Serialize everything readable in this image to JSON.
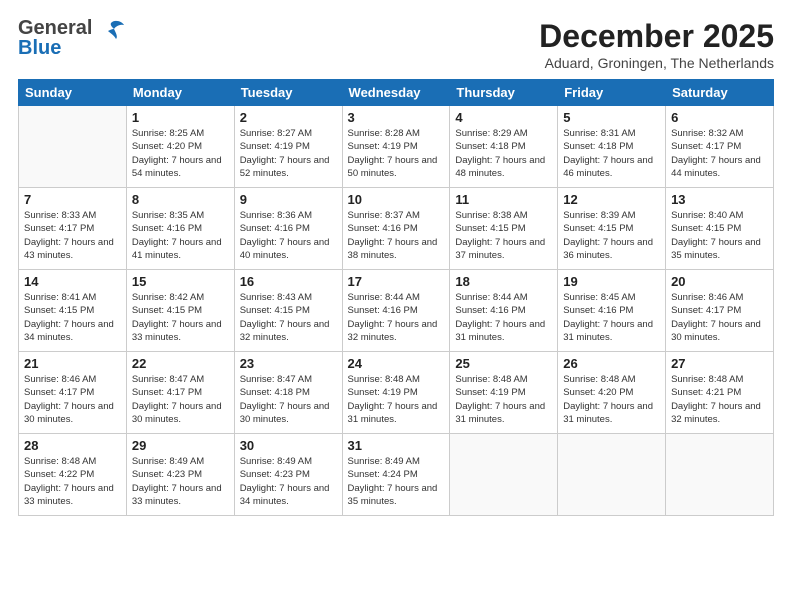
{
  "header": {
    "logo_general": "General",
    "logo_blue": "Blue",
    "month_title": "December 2025",
    "location": "Aduard, Groningen, The Netherlands"
  },
  "weekdays": [
    "Sunday",
    "Monday",
    "Tuesday",
    "Wednesday",
    "Thursday",
    "Friday",
    "Saturday"
  ],
  "weeks": [
    [
      {
        "day": "",
        "sunrise": "",
        "sunset": "",
        "daylight": ""
      },
      {
        "day": "1",
        "sunrise": "Sunrise: 8:25 AM",
        "sunset": "Sunset: 4:20 PM",
        "daylight": "Daylight: 7 hours and 54 minutes."
      },
      {
        "day": "2",
        "sunrise": "Sunrise: 8:27 AM",
        "sunset": "Sunset: 4:19 PM",
        "daylight": "Daylight: 7 hours and 52 minutes."
      },
      {
        "day": "3",
        "sunrise": "Sunrise: 8:28 AM",
        "sunset": "Sunset: 4:19 PM",
        "daylight": "Daylight: 7 hours and 50 minutes."
      },
      {
        "day": "4",
        "sunrise": "Sunrise: 8:29 AM",
        "sunset": "Sunset: 4:18 PM",
        "daylight": "Daylight: 7 hours and 48 minutes."
      },
      {
        "day": "5",
        "sunrise": "Sunrise: 8:31 AM",
        "sunset": "Sunset: 4:18 PM",
        "daylight": "Daylight: 7 hours and 46 minutes."
      },
      {
        "day": "6",
        "sunrise": "Sunrise: 8:32 AM",
        "sunset": "Sunset: 4:17 PM",
        "daylight": "Daylight: 7 hours and 44 minutes."
      }
    ],
    [
      {
        "day": "7",
        "sunrise": "Sunrise: 8:33 AM",
        "sunset": "Sunset: 4:17 PM",
        "daylight": "Daylight: 7 hours and 43 minutes."
      },
      {
        "day": "8",
        "sunrise": "Sunrise: 8:35 AM",
        "sunset": "Sunset: 4:16 PM",
        "daylight": "Daylight: 7 hours and 41 minutes."
      },
      {
        "day": "9",
        "sunrise": "Sunrise: 8:36 AM",
        "sunset": "Sunset: 4:16 PM",
        "daylight": "Daylight: 7 hours and 40 minutes."
      },
      {
        "day": "10",
        "sunrise": "Sunrise: 8:37 AM",
        "sunset": "Sunset: 4:16 PM",
        "daylight": "Daylight: 7 hours and 38 minutes."
      },
      {
        "day": "11",
        "sunrise": "Sunrise: 8:38 AM",
        "sunset": "Sunset: 4:15 PM",
        "daylight": "Daylight: 7 hours and 37 minutes."
      },
      {
        "day": "12",
        "sunrise": "Sunrise: 8:39 AM",
        "sunset": "Sunset: 4:15 PM",
        "daylight": "Daylight: 7 hours and 36 minutes."
      },
      {
        "day": "13",
        "sunrise": "Sunrise: 8:40 AM",
        "sunset": "Sunset: 4:15 PM",
        "daylight": "Daylight: 7 hours and 35 minutes."
      }
    ],
    [
      {
        "day": "14",
        "sunrise": "Sunrise: 8:41 AM",
        "sunset": "Sunset: 4:15 PM",
        "daylight": "Daylight: 7 hours and 34 minutes."
      },
      {
        "day": "15",
        "sunrise": "Sunrise: 8:42 AM",
        "sunset": "Sunset: 4:15 PM",
        "daylight": "Daylight: 7 hours and 33 minutes."
      },
      {
        "day": "16",
        "sunrise": "Sunrise: 8:43 AM",
        "sunset": "Sunset: 4:15 PM",
        "daylight": "Daylight: 7 hours and 32 minutes."
      },
      {
        "day": "17",
        "sunrise": "Sunrise: 8:44 AM",
        "sunset": "Sunset: 4:16 PM",
        "daylight": "Daylight: 7 hours and 32 minutes."
      },
      {
        "day": "18",
        "sunrise": "Sunrise: 8:44 AM",
        "sunset": "Sunset: 4:16 PM",
        "daylight": "Daylight: 7 hours and 31 minutes."
      },
      {
        "day": "19",
        "sunrise": "Sunrise: 8:45 AM",
        "sunset": "Sunset: 4:16 PM",
        "daylight": "Daylight: 7 hours and 31 minutes."
      },
      {
        "day": "20",
        "sunrise": "Sunrise: 8:46 AM",
        "sunset": "Sunset: 4:17 PM",
        "daylight": "Daylight: 7 hours and 30 minutes."
      }
    ],
    [
      {
        "day": "21",
        "sunrise": "Sunrise: 8:46 AM",
        "sunset": "Sunset: 4:17 PM",
        "daylight": "Daylight: 7 hours and 30 minutes."
      },
      {
        "day": "22",
        "sunrise": "Sunrise: 8:47 AM",
        "sunset": "Sunset: 4:17 PM",
        "daylight": "Daylight: 7 hours and 30 minutes."
      },
      {
        "day": "23",
        "sunrise": "Sunrise: 8:47 AM",
        "sunset": "Sunset: 4:18 PM",
        "daylight": "Daylight: 7 hours and 30 minutes."
      },
      {
        "day": "24",
        "sunrise": "Sunrise: 8:48 AM",
        "sunset": "Sunset: 4:19 PM",
        "daylight": "Daylight: 7 hours and 31 minutes."
      },
      {
        "day": "25",
        "sunrise": "Sunrise: 8:48 AM",
        "sunset": "Sunset: 4:19 PM",
        "daylight": "Daylight: 7 hours and 31 minutes."
      },
      {
        "day": "26",
        "sunrise": "Sunrise: 8:48 AM",
        "sunset": "Sunset: 4:20 PM",
        "daylight": "Daylight: 7 hours and 31 minutes."
      },
      {
        "day": "27",
        "sunrise": "Sunrise: 8:48 AM",
        "sunset": "Sunset: 4:21 PM",
        "daylight": "Daylight: 7 hours and 32 minutes."
      }
    ],
    [
      {
        "day": "28",
        "sunrise": "Sunrise: 8:48 AM",
        "sunset": "Sunset: 4:22 PM",
        "daylight": "Daylight: 7 hours and 33 minutes."
      },
      {
        "day": "29",
        "sunrise": "Sunrise: 8:49 AM",
        "sunset": "Sunset: 4:23 PM",
        "daylight": "Daylight: 7 hours and 33 minutes."
      },
      {
        "day": "30",
        "sunrise": "Sunrise: 8:49 AM",
        "sunset": "Sunset: 4:23 PM",
        "daylight": "Daylight: 7 hours and 34 minutes."
      },
      {
        "day": "31",
        "sunrise": "Sunrise: 8:49 AM",
        "sunset": "Sunset: 4:24 PM",
        "daylight": "Daylight: 7 hours and 35 minutes."
      },
      {
        "day": "",
        "sunrise": "",
        "sunset": "",
        "daylight": ""
      },
      {
        "day": "",
        "sunrise": "",
        "sunset": "",
        "daylight": ""
      },
      {
        "day": "",
        "sunrise": "",
        "sunset": "",
        "daylight": ""
      }
    ]
  ]
}
